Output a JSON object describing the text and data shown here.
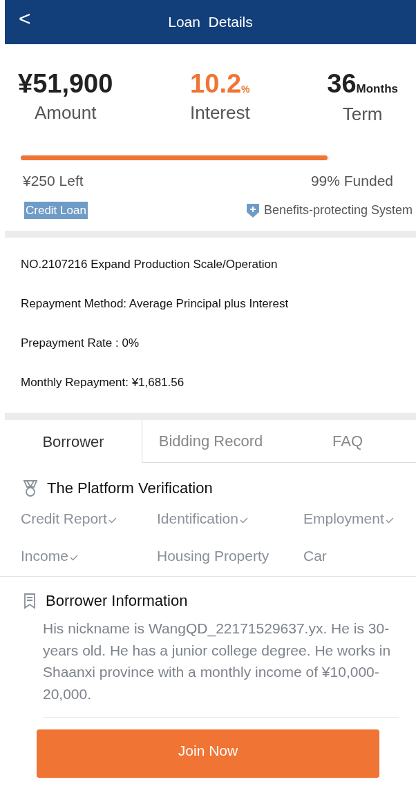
{
  "header": {
    "back": "<",
    "title": "Loan  Details"
  },
  "stats": [
    {
      "value": "¥51,900",
      "label": "Amount",
      "highlight": false
    },
    {
      "value": "10.2",
      "unit": "%",
      "label": "Interest",
      "highlight": true
    },
    {
      "value": "36",
      "unit": "Months",
      "label": "Term",
      "highlight": false
    }
  ],
  "progress": {
    "level": 0.99,
    "left": "¥250 Left",
    "funded": "99% Funded"
  },
  "tag": "Credit Loan",
  "protection": "Benefits-protecting System",
  "details": [
    "NO.2107216 Expand Production Scale/Operation",
    "Repayment Method: Average Principal plus Interest",
    "Prepayment Rate :  0%",
    "Monthly Repayment: ¥1,681.56"
  ],
  "tabs": [
    {
      "label": "Borrower",
      "selected": true
    },
    {
      "label": "Bidding Record",
      "selected": false
    },
    {
      "label": "FAQ",
      "selected": false
    }
  ],
  "verification": {
    "title": "The Platform Verification",
    "items": [
      {
        "label": "Credit Report",
        "verified": true
      },
      {
        "label": "Identification",
        "verified": true
      },
      {
        "label": "Employment",
        "verified": true
      },
      {
        "label": "Income",
        "verified": true
      },
      {
        "label": "Housing Property",
        "verified": false
      },
      {
        "label": "Car",
        "verified": false
      }
    ]
  },
  "borrower_info": {
    "title": "Borrower Information",
    "text": "His nickname is WangQD_22171529637.yx. He is 30-years old. He has a junior college degree. He works in Shaanxi province with a monthly income of ¥10,000-20,000."
  },
  "button": "Join Now"
}
